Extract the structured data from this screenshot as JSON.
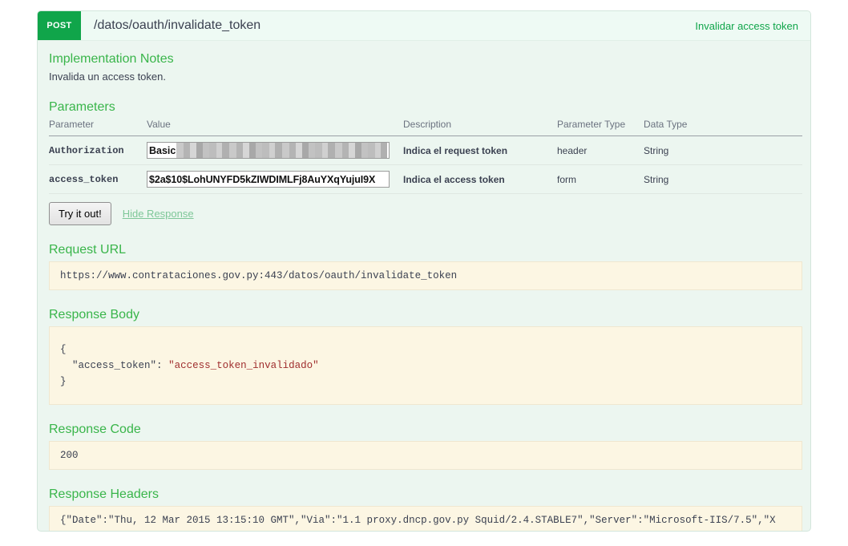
{
  "operation": {
    "method": "POST",
    "path": "/datos/oauth/invalidate_token",
    "summary": "Invalidar access token"
  },
  "implementation_notes": {
    "title": "Implementation Notes",
    "text": "Invalida un access token."
  },
  "parameters_section": {
    "title": "Parameters",
    "columns": {
      "parameter": "Parameter",
      "value": "Value",
      "description": "Description",
      "parameter_type": "Parameter Type",
      "data_type": "Data Type"
    },
    "rows": [
      {
        "parameter": "Authorization",
        "value": "Basic",
        "value_redacted": true,
        "description": "Indica el request token",
        "parameter_type": "header",
        "data_type": "String"
      },
      {
        "parameter": "access_token",
        "value": "$2a$10$LohUNYFD5kZIWDIMLFj8AuYXqYujuI9X",
        "value_redacted": false,
        "description": "Indica el access token",
        "parameter_type": "form",
        "data_type": "String"
      }
    ]
  },
  "actions": {
    "try_it_out": "Try it out!",
    "hide_response": "Hide Response"
  },
  "request_url": {
    "title": "Request URL",
    "value": "https://www.contrataciones.gov.py:443/datos/oauth/invalidate_token"
  },
  "response_body": {
    "title": "Response Body",
    "open_brace": "{",
    "key": "\"access_token\":",
    "value": "\"access_token_invalidado\"",
    "close_brace": "}"
  },
  "response_code": {
    "title": "Response Code",
    "value": "200"
  },
  "response_headers": {
    "title": "Response Headers",
    "value": "{\"Date\":\"Thu, 12 Mar 2015 13:15:10 GMT\",\"Via\":\"1.1 proxy.dncp.gov.py Squid/2.4.STABLE7\",\"Server\":\"Microsoft-IIS/7.5\",\"X",
    "scroll_left_arrow": "◀",
    "scroll_right_arrow": "▶"
  },
  "colors": {
    "method_post": "#10a54a",
    "accent_green": "#39b54a",
    "panel_bg": "#ecf6f0",
    "code_bg": "#fcf6e3",
    "json_string": "#9f2d2d"
  }
}
